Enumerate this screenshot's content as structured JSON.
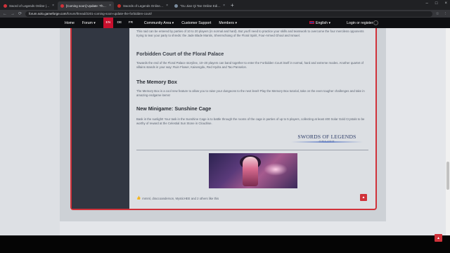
{
  "browser": {
    "tabs": [
      {
        "title": "Sword of Legends Online | Ga",
        "favicon_color": "#d0323a",
        "active": false
      },
      {
        "title": "[Coming soon] Update: The Fo",
        "favicon_color": "#d0323a",
        "active": true
      },
      {
        "title": "Swords of Legends Online: The F",
        "favicon_color": "#c4302b",
        "active": false
      },
      {
        "title": "\"Gu Jian Qi Tan Online Edition\" I",
        "favicon_color": "#7a8c9e",
        "active": false
      }
    ],
    "tab_close": "×",
    "new_tab": "+",
    "window_controls": [
      "–",
      "□",
      "×"
    ],
    "url_host": "forum.solo.gameforge.com",
    "url_path": "/forum/thread/2201-coming-soon-update-the-forbidden-court/",
    "nav_buttons": [
      "←",
      "→",
      "⟳"
    ],
    "right_icons": [
      "☆",
      "⋮"
    ]
  },
  "site_nav": {
    "items": [
      "Home",
      "Forum ▾",
      "Community Area ▾",
      "Customer Support",
      "Members ▾"
    ],
    "languages": [
      {
        "code": "EN",
        "active": true
      },
      {
        "code": "DE",
        "active": false
      },
      {
        "code": "FR",
        "active": false
      }
    ],
    "language_select": "English ▾",
    "login": "Login or register"
  },
  "post": {
    "intro": "This raid can be entered by parties of 10 to 20 players (in normal and hard). But you'll need to practice your skills and teamwork to overcome the four merciless opponents trying to tear your party to shreds: the Jade Blade Mantis, Shenmchiang of the Floral Spirit, Four-Armed Ghoul and Ismael.",
    "floral_heading": "Forbidden Court of the Floral Palace",
    "floral_text": "Towards the end of the Floral Palace storyline, 10–20 players can band together to enter the Forbidden Court itself in normal, hard and extreme modes. Another quartet of villains stands in your way: Ruin Flower, Kaisengdu, Red Hydra and Tao Panselon.",
    "memory_heading": "The Memory Box",
    "memory_text": "The Memory Box is a cool new feature to allow you to raise your dungeons to the next level! Play the Memory Box tutorial, take on the even tougher challenges and take in amazing endgame items!",
    "cage_heading": "New Minigame: Sunshine Cage",
    "cage_text": "Bask in the sunlight! Your task in the Sunshine Cage is to battle through the rooms of the cage in parties of up to 5 players, collecting at least 400 Solar Gold Crystals to be worthy of reward at the Celestial Sun Stone in Cloudrise.",
    "logo_line1": "SWORDS OF LEGENDS",
    "logo_line2": "ONLINE",
    "likes": "mmml, draccoanderson, MysticHEE and 2 others like this"
  },
  "icons": {
    "thumb": "👍",
    "report": "▲",
    "scroll_top": "▲"
  },
  "colors": {
    "accent": "#d0323a",
    "nav_bg": "#0e0f12",
    "side_column": "#323742"
  }
}
